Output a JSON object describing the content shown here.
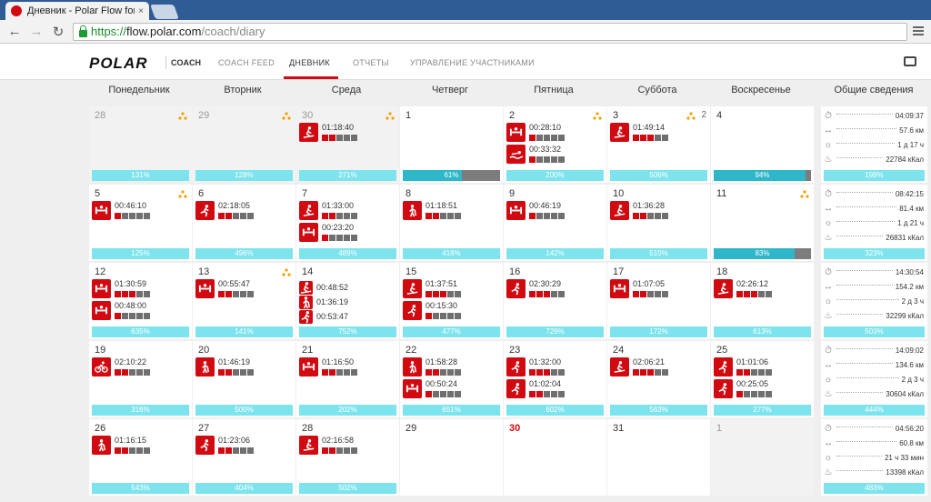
{
  "browser": {
    "tab_title": "Дневник - Polar Flow for C",
    "tab_close": "×",
    "url_scheme": "https://",
    "url_host": "flow.polar.com",
    "url_path": "/coach/diary"
  },
  "nav": {
    "logo": "POLAR",
    "coach": "COACH",
    "items": [
      "COACH FEED",
      "ДНЕВНИК",
      "ОТЧЕТЫ",
      "УПРАВЛЕНИЕ УЧАСТНИКАМИ"
    ],
    "active": 1
  },
  "weekdays": [
    "Понедельник",
    "Вторник",
    "Среда",
    "Четверг",
    "Пятница",
    "Суббота",
    "Воскресенье",
    "Общие сведения"
  ],
  "colors": {
    "accent": "#d10a11",
    "bar": "#7de4ee",
    "bar_fill": "#2db7c9"
  },
  "weeks": [
    {
      "days": [
        {
          "d": "28",
          "prev": true,
          "warn": true,
          "ex": [],
          "pct": "131%",
          "fill": 0
        },
        {
          "d": "29",
          "prev": true,
          "warn": true,
          "ex": [],
          "pct": "128%",
          "fill": 0
        },
        {
          "d": "30",
          "prev": true,
          "warn": true,
          "ex": [
            {
              "icon": "ski-icon",
              "t": "01:18:40",
              "z": 2
            }
          ],
          "pct": "271%",
          "fill": 0
        },
        {
          "d": "1",
          "ex": [],
          "pct": "61%",
          "fill": 0.61
        },
        {
          "d": "2",
          "warn": true,
          "ex": [
            {
              "icon": "weights-icon",
              "t": "00:28:10",
              "z": 1
            },
            {
              "icon": "swim-icon",
              "t": "00:33:32",
              "z": 1
            }
          ],
          "pct": "200%",
          "fill": 0
        },
        {
          "d": "3",
          "warn": true,
          "extra": "2",
          "ex": [
            {
              "icon": "ski-icon",
              "t": "01:49:14",
              "z": 3
            }
          ],
          "pct": "506%",
          "fill": 0
        },
        {
          "d": "4",
          "ex": [],
          "pct": "94%",
          "fill": 0.94
        }
      ],
      "sum": {
        "time": "04:09:37",
        "dist": "57.6 км",
        "recovery": "1 д 17 ч",
        "cal": "22784 кКал",
        "pct": "199%"
      }
    },
    {
      "days": [
        {
          "d": "5",
          "warn": true,
          "ex": [
            {
              "icon": "weights-icon",
              "t": "00:46:10",
              "z": 1
            }
          ],
          "pct": "125%",
          "fill": 0
        },
        {
          "d": "6",
          "ex": [
            {
              "icon": "run-icon",
              "t": "02:18:05",
              "z": 2
            }
          ],
          "pct": "496%",
          "fill": 0
        },
        {
          "d": "7",
          "ex": [
            {
              "icon": "ski-icon",
              "t": "01:33:00",
              "z": 2
            },
            {
              "icon": "weights-icon",
              "t": "00:23:20",
              "z": 1
            }
          ],
          "pct": "489%",
          "fill": 0
        },
        {
          "d": "8",
          "ex": [
            {
              "icon": "walk-icon",
              "t": "01:18:51",
              "z": 2
            }
          ],
          "pct": "418%",
          "fill": 0
        },
        {
          "d": "9",
          "ex": [
            {
              "icon": "weights-icon",
              "t": "00:46:19",
              "z": 1
            }
          ],
          "pct": "142%",
          "fill": 0
        },
        {
          "d": "10",
          "ex": [
            {
              "icon": "ski-icon",
              "t": "01:36:28",
              "z": 2
            }
          ],
          "pct": "510%",
          "fill": 0
        },
        {
          "d": "11",
          "warn": true,
          "ex": [],
          "pct": "83%",
          "fill": 0.83
        }
      ],
      "sum": {
        "time": "08:42:15",
        "dist": "81.4 км",
        "recovery": "1 д 21 ч",
        "cal": "26831 кКал",
        "pct": "323%"
      }
    },
    {
      "days": [
        {
          "d": "12",
          "ex": [
            {
              "icon": "weights-icon",
              "t": "01:30:59",
              "z": 3
            },
            {
              "icon": "weights-icon",
              "t": "00:48:00",
              "z": 1
            }
          ],
          "pct": "635%",
          "fill": 0
        },
        {
          "d": "13",
          "warn": true,
          "ex": [
            {
              "icon": "weights-icon",
              "t": "00:55:47",
              "z": 2
            }
          ],
          "pct": "141%",
          "fill": 0
        },
        {
          "d": "14",
          "ex": [
            {
              "icon": "ski-icon",
              "t": "00:48:52",
              "z": 0
            },
            {
              "icon": "walk-icon",
              "t": "01:36:19",
              "z": 0
            },
            {
              "icon": "run-icon",
              "t": "00:53:47",
              "z": 0
            }
          ],
          "pct": "752%",
          "fill": 0
        },
        {
          "d": "15",
          "ex": [
            {
              "icon": "ski-icon",
              "t": "01:37:51",
              "z": 3
            },
            {
              "icon": "run-icon",
              "t": "00:15:30",
              "z": 1
            }
          ],
          "pct": "477%",
          "fill": 0
        },
        {
          "d": "16",
          "ex": [
            {
              "icon": "run-icon",
              "t": "02:30:29",
              "z": 3
            }
          ],
          "pct": "729%",
          "fill": 0
        },
        {
          "d": "17",
          "ex": [
            {
              "icon": "weights-icon",
              "t": "01:07:05",
              "z": 2
            }
          ],
          "pct": "172%",
          "fill": 0
        },
        {
          "d": "18",
          "ex": [
            {
              "icon": "ski-icon",
              "t": "02:26:12",
              "z": 3
            }
          ],
          "pct": "613%",
          "fill": 0
        }
      ],
      "sum": {
        "time": "14:30:54",
        "dist": "154.2 км",
        "recovery": "2 д 3 ч",
        "cal": "32299 кКал",
        "pct": "503%"
      }
    },
    {
      "days": [
        {
          "d": "19",
          "ex": [
            {
              "icon": "bike-icon",
              "t": "02:10:22",
              "z": 2
            }
          ],
          "pct": "316%",
          "fill": 0
        },
        {
          "d": "20",
          "ex": [
            {
              "icon": "walk-icon",
              "t": "01:46:19",
              "z": 2
            }
          ],
          "pct": "500%",
          "fill": 0
        },
        {
          "d": "21",
          "ex": [
            {
              "icon": "weights-icon",
              "t": "01:16:50",
              "z": 2
            }
          ],
          "pct": "202%",
          "fill": 0
        },
        {
          "d": "22",
          "ex": [
            {
              "icon": "walk-icon",
              "t": "01:58:28",
              "z": 2
            },
            {
              "icon": "weights-icon",
              "t": "00:50:24",
              "z": 1
            }
          ],
          "pct": "651%",
          "fill": 0
        },
        {
          "d": "23",
          "ex": [
            {
              "icon": "run-icon",
              "t": "01:32:00",
              "z": 3
            },
            {
              "icon": "run-icon",
              "t": "01:02:04",
              "z": 2
            }
          ],
          "pct": "602%",
          "fill": 0
        },
        {
          "d": "24",
          "ex": [
            {
              "icon": "ski-icon",
              "t": "02:06:21",
              "z": 3
            }
          ],
          "pct": "563%",
          "fill": 0
        },
        {
          "d": "25",
          "ex": [
            {
              "icon": "run-icon",
              "t": "01:01:06",
              "z": 2
            },
            {
              "icon": "run-icon",
              "t": "00:25:05",
              "z": 1
            }
          ],
          "pct": "277%",
          "fill": 0
        }
      ],
      "sum": {
        "time": "14:09:02",
        "dist": "134.6 км",
        "recovery": "2 д 3 ч",
        "cal": "30604 кКал",
        "pct": "444%"
      }
    },
    {
      "days": [
        {
          "d": "26",
          "ex": [
            {
              "icon": "walk-icon",
              "t": "01:16:15",
              "z": 2
            }
          ],
          "pct": "543%",
          "fill": 0
        },
        {
          "d": "27",
          "ex": [
            {
              "icon": "run-icon",
              "t": "01:23:06",
              "z": 2
            }
          ],
          "pct": "404%",
          "fill": 0
        },
        {
          "d": "28",
          "ex": [
            {
              "icon": "ski-icon",
              "t": "02:16:58",
              "z": 2
            }
          ],
          "pct": "502%",
          "fill": 0
        },
        {
          "d": "29",
          "ex": [],
          "pct": "",
          "fill": 0
        },
        {
          "d": "30",
          "today": true,
          "ex": [],
          "pct": "",
          "fill": 0
        },
        {
          "d": "31",
          "ex": [],
          "pct": "",
          "fill": 0
        },
        {
          "d": "1",
          "prev": true,
          "ex": [],
          "pct": "",
          "fill": 0
        }
      ],
      "sum": {
        "time": "04:56:20",
        "dist": "60.8 км",
        "recovery": "21 ч 33 мин",
        "cal": "13398 кКал",
        "pct": "483%"
      }
    }
  ]
}
